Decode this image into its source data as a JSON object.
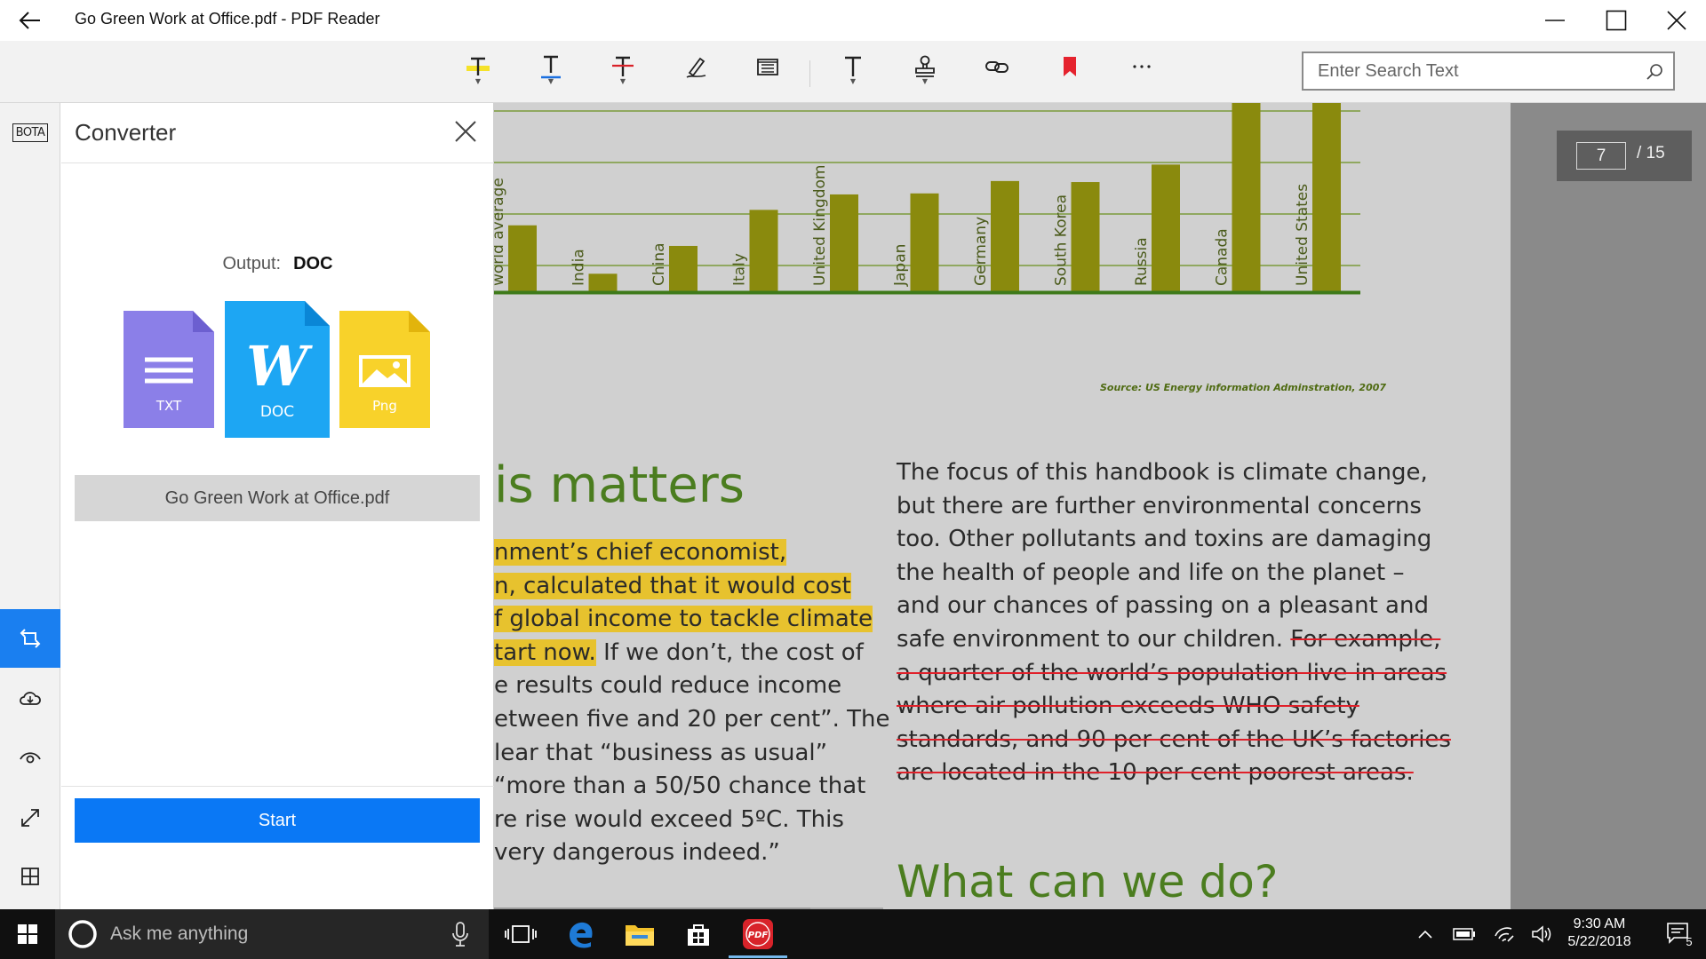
{
  "window": {
    "title": "Go Green Work at Office.pdf - PDF Reader"
  },
  "toolbar": {
    "tools": [
      {
        "name": "highlight-tool",
        "glyph": "T"
      },
      {
        "name": "underline-tool",
        "glyph": "T"
      },
      {
        "name": "strikethrough-tool",
        "glyph": "T"
      },
      {
        "name": "freehand-tool"
      },
      {
        "name": "note-tool"
      },
      {
        "name": "text-tool",
        "glyph": "T"
      },
      {
        "name": "stamp-tool"
      },
      {
        "name": "link-tool"
      },
      {
        "name": "bookmark-tool"
      },
      {
        "name": "more-tool",
        "glyph": "···"
      }
    ],
    "search_placeholder": "Enter Search Text"
  },
  "rail": {
    "bota_label": "BOTA"
  },
  "converter": {
    "title": "Converter",
    "output_label": "Output:",
    "output_value": "DOC",
    "formats": [
      {
        "label": "TXT",
        "color": "#8b7fe8"
      },
      {
        "label": "DOC",
        "color": "#1da6f3"
      },
      {
        "label": "Png",
        "color": "#f8d22a"
      }
    ],
    "file_name": "Go Green Work at Office.pdf",
    "start_label": "Start"
  },
  "page_indicator": {
    "current": "7",
    "total": "/ 15"
  },
  "chart_data": {
    "type": "bar",
    "categories": [
      "World average",
      "India",
      "China",
      "Italy",
      "United Kingdom",
      "Japan",
      "Germany",
      "South Korea",
      "Russia",
      "Canada",
      "United States"
    ],
    "values": [
      6.4,
      1.7,
      4.4,
      7.9,
      9.4,
      9.5,
      10.7,
      10.6,
      12.3,
      19.2,
      19.6
    ],
    "visible_category_labels": [
      "world average",
      "India",
      "China",
      "Italy",
      "United Kingdom",
      "Japan",
      "Germany",
      "South Korea",
      "Russia",
      "Canada",
      "United States"
    ],
    "source": "Source: US Energy information Adminstration, 2007",
    "bar_color": "#8a8a0d",
    "grid_color": "#7a9a3a",
    "grid": true
  },
  "document": {
    "heading_partial": "is matters",
    "left_lines": [
      {
        "text": "nment’s chief economist,",
        "highlight": true
      },
      {
        "text": "n, calculated that it would cost",
        "highlight": true
      },
      {
        "text": "f global income to tackle climate",
        "highlight": true
      },
      {
        "text": "tart now.",
        "highlight": true,
        "rest": " If we don’t, the cost of"
      },
      {
        "text": "e results could reduce income"
      },
      {
        "text": "etween five and 20 per cent”. The"
      },
      {
        "text": "lear that “business as usual”"
      },
      {
        "text": "“more than a 50/50 chance that"
      },
      {
        "text": "re rise would exceed 5ºC. This"
      },
      {
        "text": "very dangerous indeed.”"
      }
    ],
    "right_lines": [
      {
        "text": "The focus of this handbook is climate change,"
      },
      {
        "text": "but there are further environmental concerns"
      },
      {
        "text": "too. Other pollutants and toxins are damaging"
      },
      {
        "text": "the health of people and life on the planet –"
      },
      {
        "text": "and our chances of passing on a pleasant and"
      },
      {
        "text": "safe environment to our children. ",
        "strike_rest": "For example,"
      },
      {
        "strike": "a quarter of the world’s population live in areas"
      },
      {
        "strike": "where air pollution exceeds WHO safety"
      },
      {
        "strike": "standards, and 90 per cent of the UK’s factories"
      },
      {
        "strike": "are located in the 10 per cent poorest areas."
      }
    ],
    "heading_what": "What can we do?"
  },
  "taskbar": {
    "search_placeholder": "Ask me anything",
    "time": "9:30 AM",
    "date": "5/22/2018",
    "notification_count": "5"
  }
}
